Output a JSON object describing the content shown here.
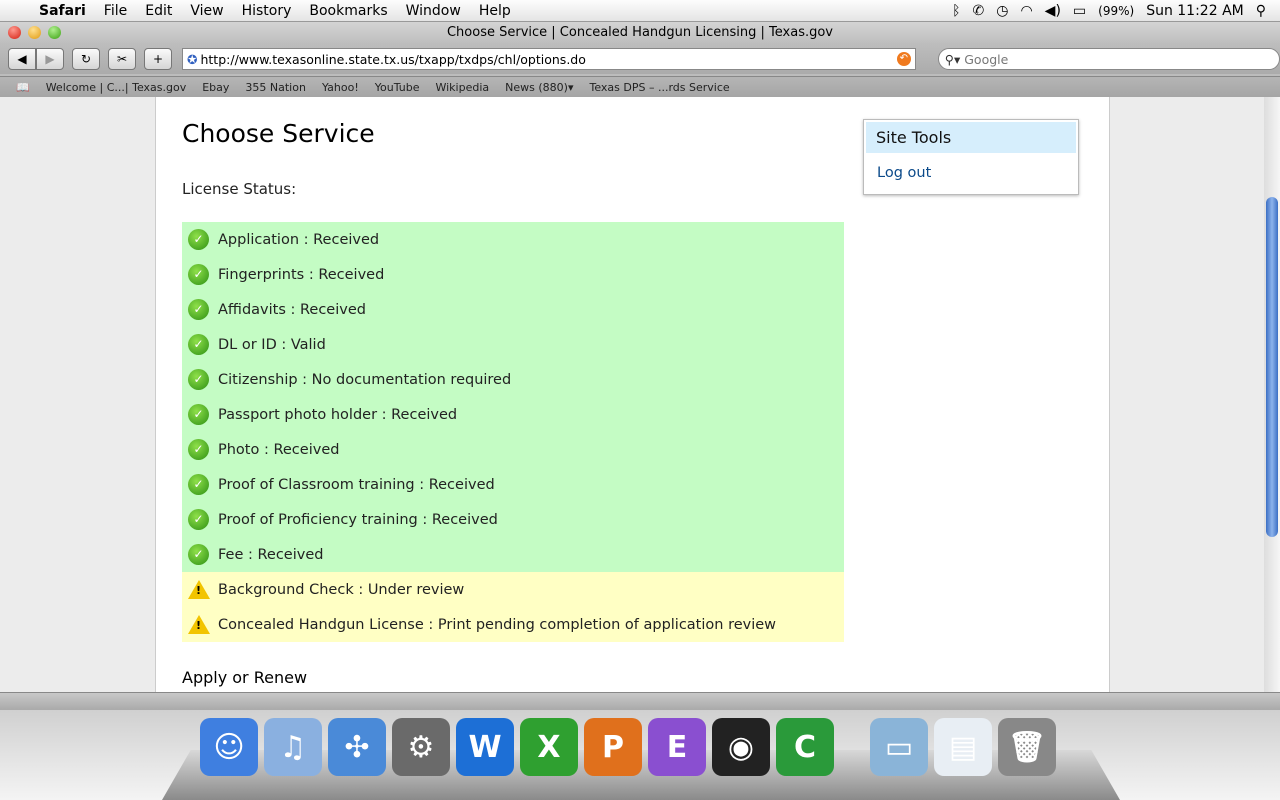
{
  "menubar": {
    "app": "Safari",
    "items": [
      "File",
      "Edit",
      "View",
      "History",
      "Bookmarks",
      "Window",
      "Help"
    ],
    "battery": "(99%)",
    "clock": "Sun 11:22 AM"
  },
  "window": {
    "title": "Choose Service | Concealed Handgun Licensing | Texas.gov",
    "url": "http://www.texasonline.state.tx.us/txapp/txdps/chl/options.do",
    "search_placeholder": "Google"
  },
  "bookmarks": [
    "Welcome | C...| Texas.gov",
    "Ebay",
    "355 Nation",
    "Yahoo!",
    "YouTube",
    "Wikipedia",
    "News (880)▾",
    "Texas DPS – ...rds Service"
  ],
  "page": {
    "title": "Choose Service",
    "status_label": "License Status:",
    "apply_heading": "Apply or Renew",
    "status": [
      {
        "text": "Application : Received",
        "state": "ok"
      },
      {
        "text": "Fingerprints : Received",
        "state": "ok"
      },
      {
        "text": "Affidavits : Received",
        "state": "ok"
      },
      {
        "text": "DL or ID : Valid",
        "state": "ok"
      },
      {
        "text": "Citizenship : No documentation required",
        "state": "ok"
      },
      {
        "text": "Passport photo holder : Received",
        "state": "ok"
      },
      {
        "text": "Photo : Received",
        "state": "ok"
      },
      {
        "text": "Proof of Classroom training : Received",
        "state": "ok"
      },
      {
        "text": "Proof of Proficiency training : Received",
        "state": "ok"
      },
      {
        "text": "Fee : Received",
        "state": "ok"
      },
      {
        "text": "Background Check : Under review",
        "state": "warn"
      },
      {
        "text": "Concealed Handgun License : Print pending completion of application review",
        "state": "warn"
      }
    ]
  },
  "site_tools": {
    "title": "Site Tools",
    "logout": "Log out"
  },
  "dock": [
    "Finder",
    "iTunes",
    "Safari",
    "System Preferences",
    "Word",
    "Excel",
    "PowerPoint",
    "Entourage",
    "Dashboard",
    "BitTorrent",
    "Documents",
    "Web page",
    "Trash"
  ]
}
